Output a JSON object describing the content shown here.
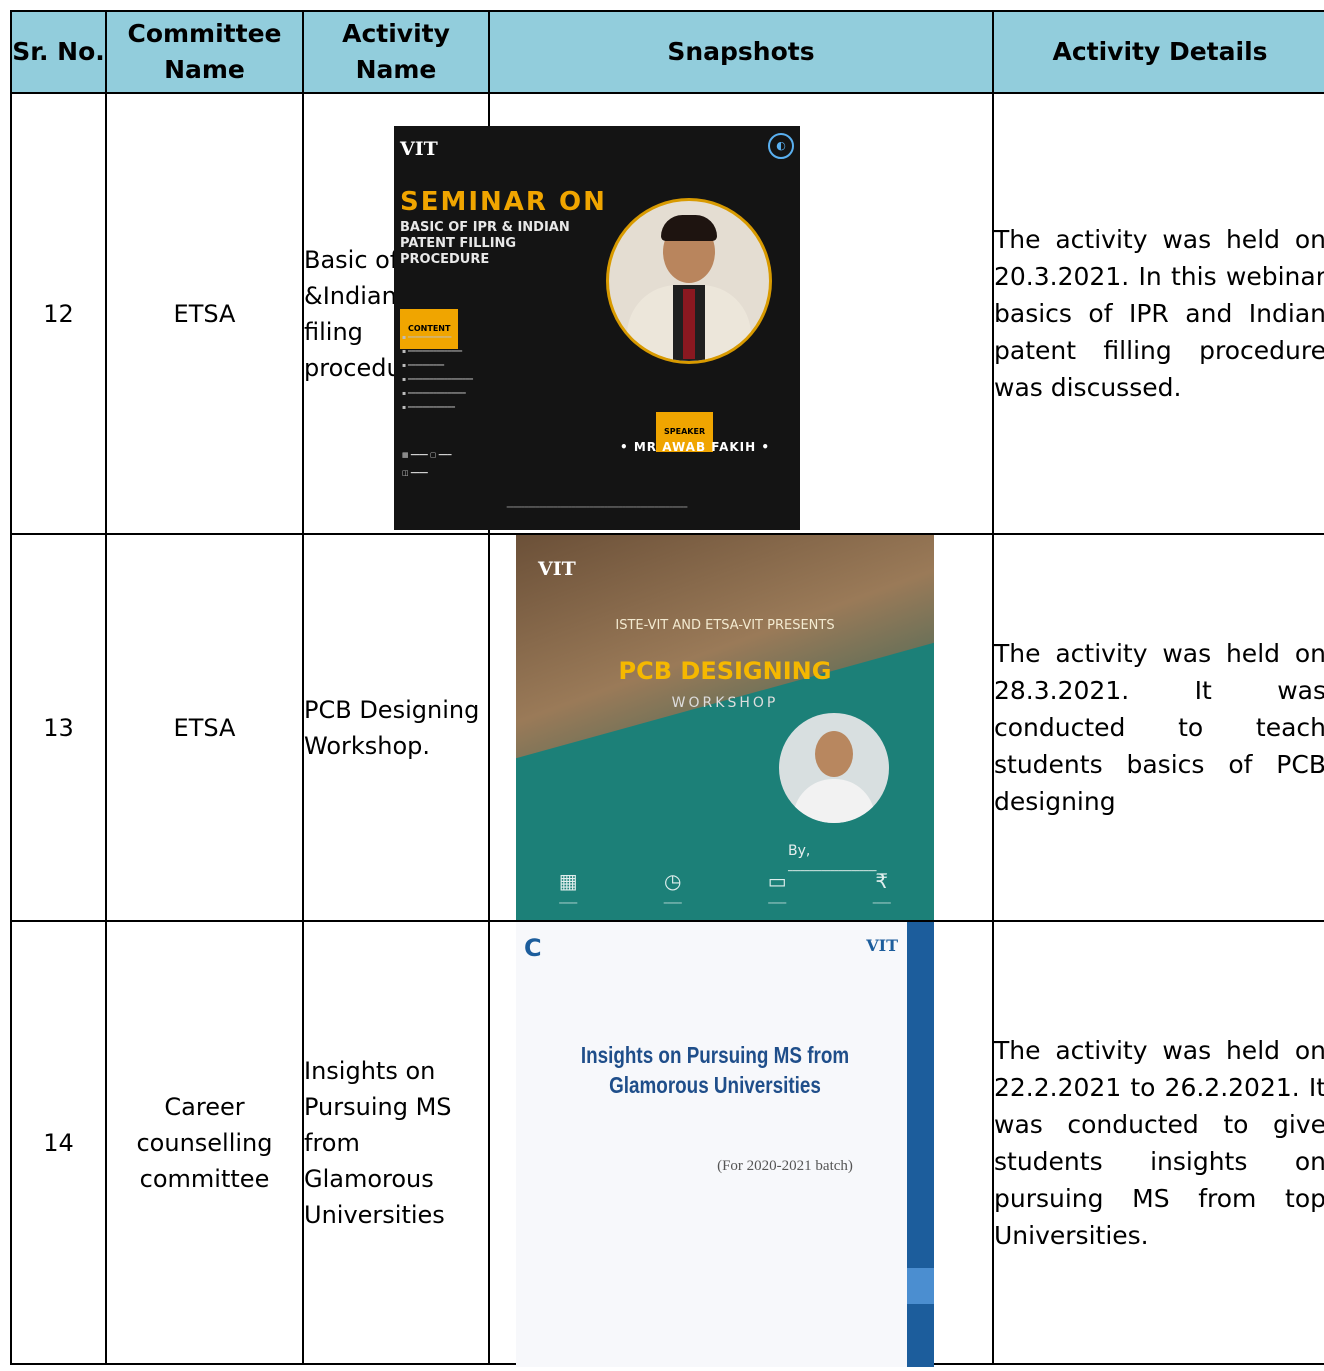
{
  "headers": {
    "sr_no": "Sr. No.",
    "committee": "Committee Name",
    "activity": "Activity Name",
    "snapshots": "Snapshots",
    "details": "Activity Details"
  },
  "rows": [
    {
      "sr": "12",
      "committee": "ETSA",
      "activity": "Basic of IPR &Indian patent filing procedure",
      "details": "The activity was held on 20.3.2021. In this webinar basics of IPR and Indian patent filling procedure was discussed.",
      "poster": {
        "logo": "VIT",
        "title": "SEMINAR ON",
        "subtitle": "BASIC OF IPR & INDIAN PATENT FILLING PROCEDURE",
        "content_tag": "CONTENT",
        "speaker_tag": "SPEAKER",
        "speaker": "• MR AWAB FAKIH •"
      }
    },
    {
      "sr": "13",
      "committee": "ETSA",
      "activity": "PCB Designing Workshop.",
      "details": "The activity was held on 28.3.2021. It was conducted to teach students basics of PCB designing",
      "poster": {
        "logo": "VIT",
        "presents": "ISTE-VIT AND ETSA-VIT PRESENTS",
        "title": "PCB DESIGNING",
        "subtitle": "WORKSHOP",
        "by": "By,"
      }
    },
    {
      "sr": "14",
      "committee": "Career counselling committee",
      "activity": "Insights on Pursuing MS from Glamorous Universities",
      "details": "The activity was held on 22.2.2021 to 26.2.2021. It was conducted to give students insights on pursuing MS from top Universities.",
      "poster": {
        "logo_left": "C",
        "logo_right": "VIT",
        "title": "Insights on Pursuing MS from Glamorous Universities",
        "batch": "(For 2020-2021 batch)"
      }
    }
  ]
}
